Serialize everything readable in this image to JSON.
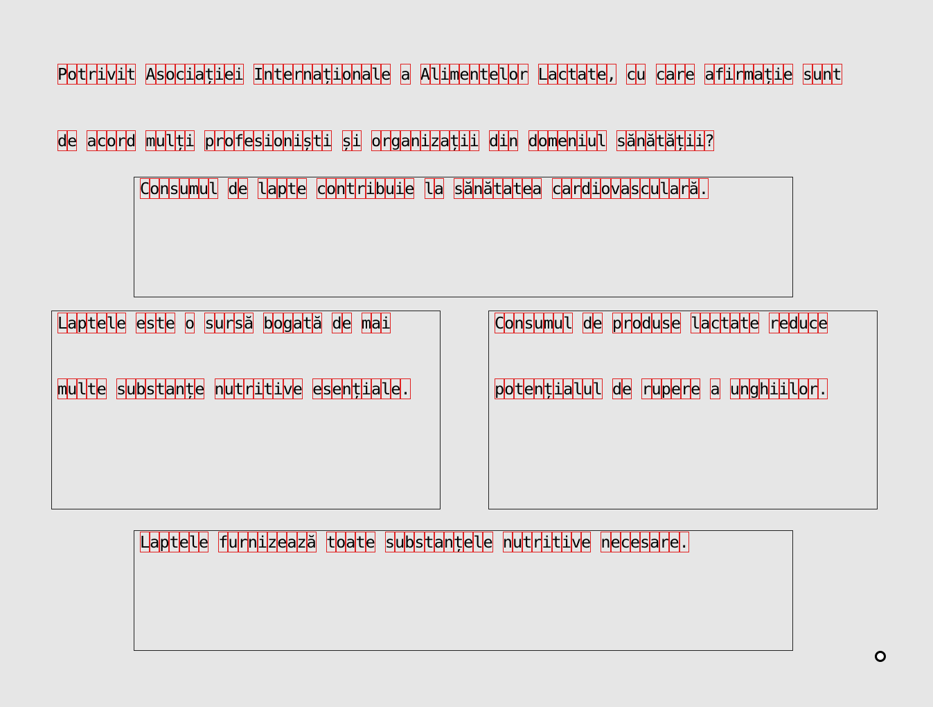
{
  "question": {
    "line1": "Potrivit Asociației Internaționale a Alimentelor Lactate, cu care afirmație sunt",
    "line2": "de acord mulți profesioniști și organizații din domeniul sănătății?"
  },
  "options": [
    {
      "id": "A",
      "lines": [
        "Consumul de lapte contribuie la sănătatea cardiovasculară."
      ]
    },
    {
      "id": "B",
      "lines": [
        "Laptele este o sursă bogată de mai",
        "multe substanțe nutritive esențiale."
      ]
    },
    {
      "id": "C",
      "lines": [
        "Consumul de produse lactate reduce",
        "potențialul de rupere a unghiilor."
      ]
    },
    {
      "id": "D",
      "lines": [
        "Laptele furnizează toate substanțele nutritive necesare."
      ]
    }
  ],
  "cursor_icon": "cursor-ring-icon"
}
